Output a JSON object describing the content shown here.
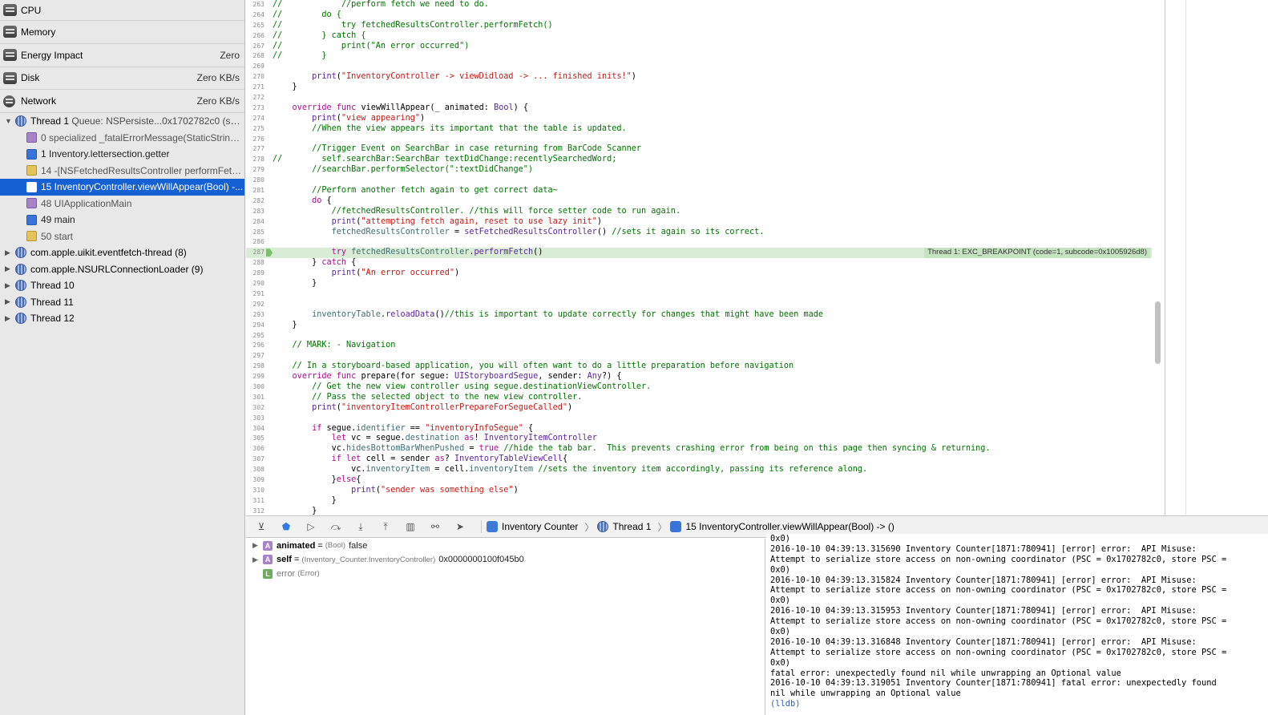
{
  "navigator": {
    "gauges": [
      {
        "label": "CPU",
        "value": "",
        "icon": "cpu-gauge-icon"
      },
      {
        "label": "Memory",
        "value": "",
        "icon": "memory-gauge-icon"
      },
      {
        "label": "Energy Impact",
        "value": "Zero",
        "icon": "energy-gauge-icon"
      },
      {
        "label": "Disk",
        "value": "Zero KB/s",
        "icon": "disk-gauge-icon"
      },
      {
        "label": "Network",
        "value": "Zero KB/s",
        "icon": "network-gauge-icon"
      }
    ],
    "thread1": {
      "label": "Thread 1",
      "sub": "Queue: NSPersiste...0x1702782c0 (serial)"
    },
    "frames": [
      {
        "label": "0 specialized _fatalErrorMessage(StaticString,...",
        "icon": "purple"
      },
      {
        "label": "1 Inventory.lettersection.getter",
        "icon": "blue"
      },
      {
        "label": "14 -[NSFetchedResultsController performFetc...",
        "icon": "yellow"
      },
      {
        "label": "15 InventoryController.viewWillAppear(Bool) -...",
        "icon": "blue"
      },
      {
        "label": "48 UIApplicationMain",
        "icon": "purple"
      },
      {
        "label": "49 main",
        "icon": "blue"
      },
      {
        "label": "50 start",
        "icon": "yellow"
      }
    ],
    "threads": [
      {
        "label": "com.apple.uikit.eventfetch-thread (8)"
      },
      {
        "label": "com.apple.NSURLConnectionLoader (9)"
      },
      {
        "label": "Thread 10"
      },
      {
        "label": "Thread 11"
      },
      {
        "label": "Thread 12"
      }
    ]
  },
  "editor": {
    "breakpoint_badge": "Thread 1: EXC_BREAKPOINT (code=1, subcode=0x1005926d8)",
    "lines": [
      {
        "n": "263",
        "t": "//            //perform fetch we need to do."
      },
      {
        "n": "264",
        "t": "//        do {"
      },
      {
        "n": "265",
        "t": "//            try fetchedResultsController.performFetch()"
      },
      {
        "n": "266",
        "t": "//        } catch {"
      },
      {
        "n": "267",
        "t": "//            print(\"An error occurred\")"
      },
      {
        "n": "268",
        "t": "//        }"
      },
      {
        "n": "269",
        "t": ""
      },
      {
        "n": "270",
        "t": "        print(\"InventoryController -> viewDidload -> ... finished inits!\")"
      },
      {
        "n": "271",
        "t": "    }"
      },
      {
        "n": "272",
        "t": ""
      },
      {
        "n": "273",
        "t": "    override func viewWillAppear(_ animated: Bool) {"
      },
      {
        "n": "274",
        "t": "        print(\"view appearing\")"
      },
      {
        "n": "275",
        "t": "        //When the view appears its important that the table is updated."
      },
      {
        "n": "276",
        "t": ""
      },
      {
        "n": "277",
        "t": "        //Trigger Event on SearchBar in case returning from BarCode Scanner"
      },
      {
        "n": "278",
        "t": "//        self.searchBar:SearchBar textDidChange:recentlySearchedWord;"
      },
      {
        "n": "279",
        "t": "        //searchBar.performSelector(\":textDidChange\")"
      },
      {
        "n": "280",
        "t": ""
      },
      {
        "n": "281",
        "t": "        //Perform another fetch again to get correct data~"
      },
      {
        "n": "282",
        "t": "        do {"
      },
      {
        "n": "283",
        "t": "            //fetchedResultsController. //this will force setter code to run again."
      },
      {
        "n": "284",
        "t": "            print(\"attempting fetch again, reset to use lazy init\")"
      },
      {
        "n": "285",
        "t": "            fetchedResultsController = setFetchedResultsController() //sets it again so its correct."
      },
      {
        "n": "286",
        "t": ""
      },
      {
        "n": "287",
        "t": "            try fetchedResultsController.performFetch()"
      },
      {
        "n": "288",
        "t": "        } catch {"
      },
      {
        "n": "289",
        "t": "            print(\"An error occurred\")"
      },
      {
        "n": "290",
        "t": "        }"
      },
      {
        "n": "291",
        "t": ""
      },
      {
        "n": "292",
        "t": ""
      },
      {
        "n": "293",
        "t": "        inventoryTable.reloadData()//this is important to update correctly for changes that might have been made"
      },
      {
        "n": "294",
        "t": "    }"
      },
      {
        "n": "295",
        "t": ""
      },
      {
        "n": "296",
        "t": "    // MARK: - Navigation"
      },
      {
        "n": "297",
        "t": ""
      },
      {
        "n": "298",
        "t": "    // In a storyboard-based application, you will often want to do a little preparation before navigation"
      },
      {
        "n": "299",
        "t": "    override func prepare(for segue: UIStoryboardSegue, sender: Any?) {"
      },
      {
        "n": "300",
        "t": "        // Get the new view controller using segue.destinationViewController."
      },
      {
        "n": "301",
        "t": "        // Pass the selected object to the new view controller."
      },
      {
        "n": "302",
        "t": "        print(\"inventoryItemControllerPrepareForSegueCalled\")"
      },
      {
        "n": "303",
        "t": ""
      },
      {
        "n": "304",
        "t": "        if segue.identifier == \"inventoryInfoSegue\" {"
      },
      {
        "n": "305",
        "t": "            let vc = segue.destination as! InventoryItemController"
      },
      {
        "n": "306",
        "t": "            vc.hidesBottomBarWhenPushed = true //hide the tab bar.  This prevents crashing error from being on this page then syncing & returning."
      },
      {
        "n": "307",
        "t": "            if let cell = sender as? InventoryTableViewCell{"
      },
      {
        "n": "308",
        "t": "                vc.inventoryItem = cell.inventoryItem //sets the inventory item accordingly, passing its reference along."
      },
      {
        "n": "309",
        "t": "            }else{"
      },
      {
        "n": "310",
        "t": "                print(\"sender was something else\")"
      },
      {
        "n": "311",
        "t": "            }"
      },
      {
        "n": "312",
        "t": "        }"
      },
      {
        "n": "313",
        "t": ""
      }
    ]
  },
  "debug_bar": {
    "breadcrumbs": [
      {
        "label": "Inventory Counter",
        "icon": "app"
      },
      {
        "label": "Thread 1",
        "icon": "thread"
      },
      {
        "label": "15 InventoryController.viewWillAppear(Bool) -> ()",
        "icon": "frame"
      }
    ]
  },
  "variables": [
    {
      "name": "animated",
      "type": "(Bool)",
      "value": "false",
      "badge": "A",
      "expandable": true
    },
    {
      "name": "self",
      "type": "(Inventory_Counter.InventoryController)",
      "value": "0x0000000100f045b0",
      "badge": "A",
      "expandable": true
    },
    {
      "name": "error",
      "type": "(Error)",
      "value": "",
      "badge": "L",
      "expandable": false
    }
  ],
  "console": {
    "lines": [
      "0x0)",
      "2016-10-10 04:39:13.315690 Inventory Counter[1871:780941] [error] error:  API Misuse:",
      "Attempt to serialize store access on non-owning coordinator (PSC = 0x1702782c0, store PSC =",
      "0x0)",
      "2016-10-10 04:39:13.315824 Inventory Counter[1871:780941] [error] error:  API Misuse:",
      "Attempt to serialize store access on non-owning coordinator (PSC = 0x1702782c0, store PSC =",
      "0x0)",
      "2016-10-10 04:39:13.315953 Inventory Counter[1871:780941] [error] error:  API Misuse:",
      "Attempt to serialize store access on non-owning coordinator (PSC = 0x1702782c0, store PSC =",
      "0x0)",
      "2016-10-10 04:39:13.316848 Inventory Counter[1871:780941] [error] error:  API Misuse:",
      "Attempt to serialize store access on non-owning coordinator (PSC = 0x1702782c0, store PSC =",
      "0x0)",
      "fatal error: unexpectedly found nil while unwrapping an Optional value",
      "2016-10-10 04:39:13.319051 Inventory Counter[1871:780941] fatal error: unexpectedly found",
      "nil while unwrapping an Optional value"
    ],
    "prompt": "(lldb)"
  }
}
